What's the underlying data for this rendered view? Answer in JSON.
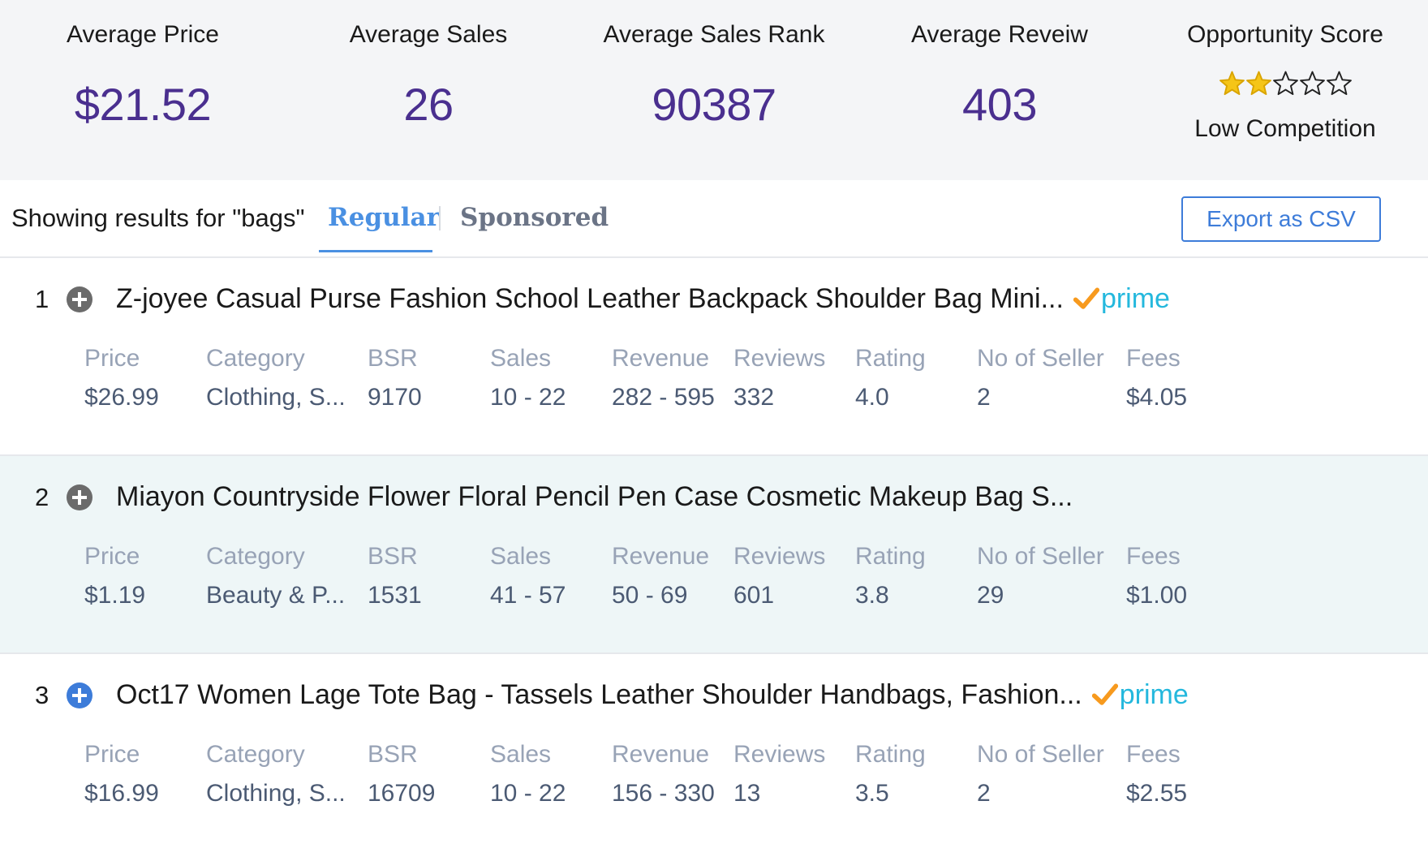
{
  "stats": [
    {
      "label": "Average Price",
      "value": "$21.52"
    },
    {
      "label": "Average Sales",
      "value": "26"
    },
    {
      "label": "Average Sales Rank",
      "value": "90387"
    },
    {
      "label": "Average Reveiw",
      "value": "403"
    }
  ],
  "opportunity": {
    "label": "Opportunity Score",
    "stars_filled": 2,
    "stars_total": 5,
    "star_color": "#f5c518",
    "sub": "Low Competition"
  },
  "toolbar": {
    "showing": "Showing results for \"bags\"",
    "tab_regular": "Regular",
    "tab_sponsored": "Sponsored",
    "export_label": "Export as CSV"
  },
  "colors": {
    "accent": "#4a90e2",
    "stat_value": "#4a2f8f",
    "prime_check": "#f79a1e",
    "prime_text": "#24b8dd",
    "alt_row": "#eef6f7"
  },
  "prime_label": "prime",
  "labels": {
    "price": "Price",
    "category": "Category",
    "bsr": "BSR",
    "sales": "Sales",
    "revenue": "Revenue",
    "reviews": "Reviews",
    "rating": "Rating",
    "sellers": "No of Seller",
    "fees": "Fees"
  },
  "products": [
    {
      "rank": "1",
      "title": "Z-joyee Casual Purse Fashion School Leather Backpack Shoulder Bag Mini...",
      "prime": true,
      "add_icon": "plus-circle-icon",
      "price": "$26.99",
      "category": "Clothing, S...",
      "bsr": "9170",
      "sales": "10 - 22",
      "revenue": "282 - 595",
      "reviews": "332",
      "rating": "4.0",
      "sellers": "2",
      "fees": "$4.05"
    },
    {
      "rank": "2",
      "title": "Miayon Countryside Flower Floral Pencil Pen Case Cosmetic Makeup Bag S...",
      "prime": false,
      "add_icon": "plus-circle-icon",
      "price": "$1.19",
      "category": "Beauty & P...",
      "bsr": "1531",
      "sales": "41 - 57",
      "revenue": "50 - 69",
      "reviews": "601",
      "rating": "3.8",
      "sellers": "29",
      "fees": "$1.00"
    },
    {
      "rank": "3",
      "title": "Oct17 Women Lage Tote Bag - Tassels Leather Shoulder Handbags, Fashion...",
      "prime": true,
      "add_icon": "plus-circle-icon",
      "price": "$16.99",
      "category": "Clothing, S...",
      "bsr": "16709",
      "sales": "10 - 22",
      "revenue": "156 - 330",
      "reviews": "13",
      "rating": "3.5",
      "sellers": "2",
      "fees": "$2.55"
    }
  ]
}
